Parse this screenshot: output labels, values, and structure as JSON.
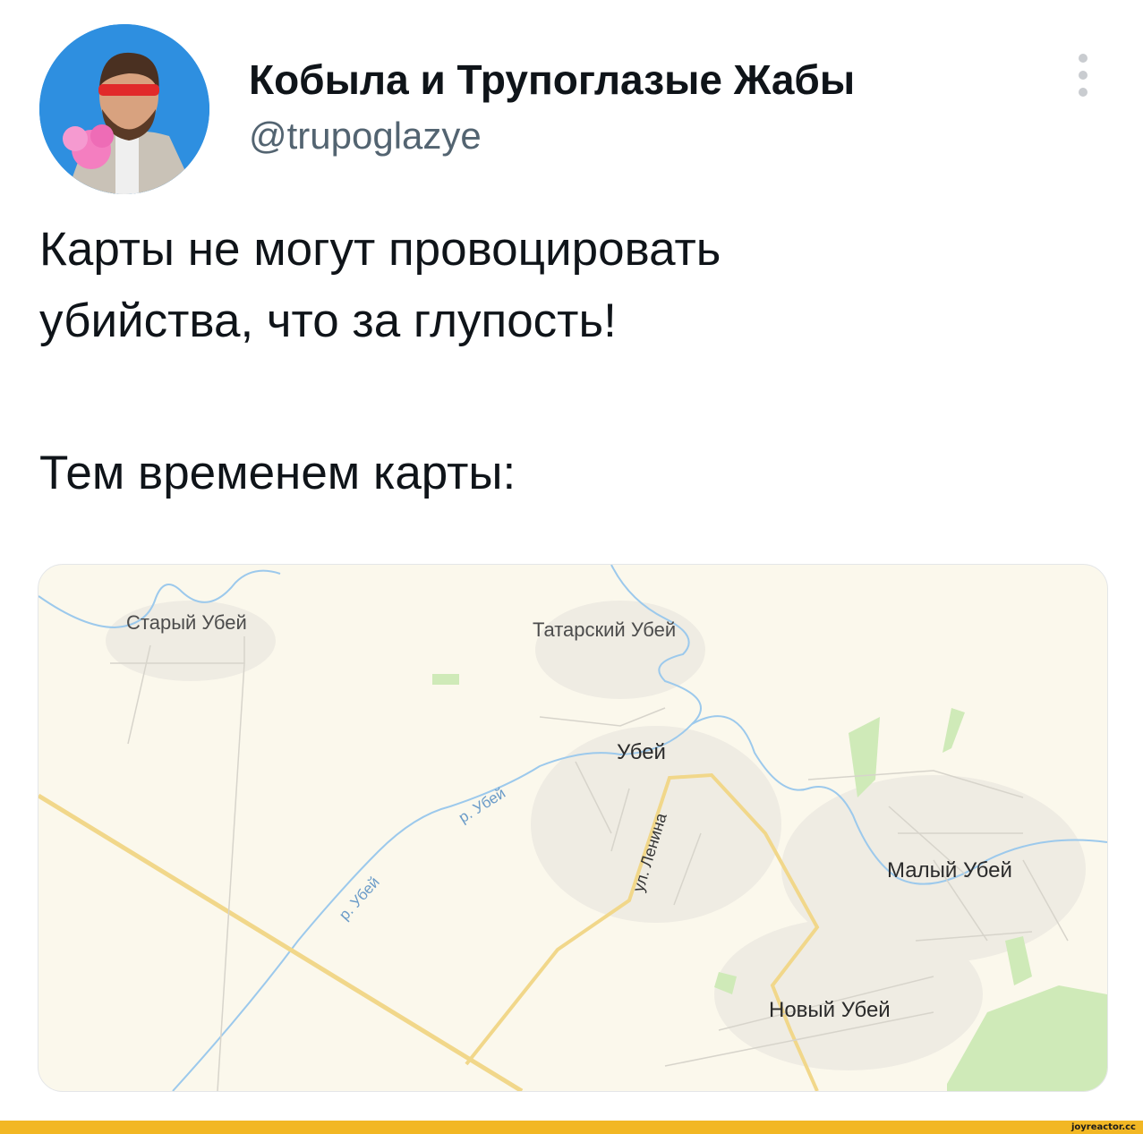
{
  "tweet": {
    "author_name": "Кобыла и Трупоглазые Жабы",
    "handle": "@trupoglazye",
    "text_line1": "Карты не могут провоцировать",
    "text_line2": "убийства, что за глупость!",
    "text_line3": "Тем временем карты:"
  },
  "map": {
    "places": {
      "stary": "Старый Убей",
      "tatarsky": "Татарский Убей",
      "ubey": "Убей",
      "maly": "Малый Убей",
      "novy": "Новый Убей"
    },
    "river_label_1": "р. Убей",
    "river_label_2": "р. Убей",
    "street_label": "ул. Ленина"
  },
  "watermark": "joyreactor.cc",
  "icons": {
    "more": "more-vertical-icon",
    "avatar": "profile-photo"
  },
  "colors": {
    "text": "#0f1419",
    "handle": "#536471",
    "map_background": "#fbf8ec",
    "road": "#f1d78a",
    "river": "#9cc9ec",
    "greenery": "#cfeab8",
    "bottom_bar": "#f2b724"
  }
}
